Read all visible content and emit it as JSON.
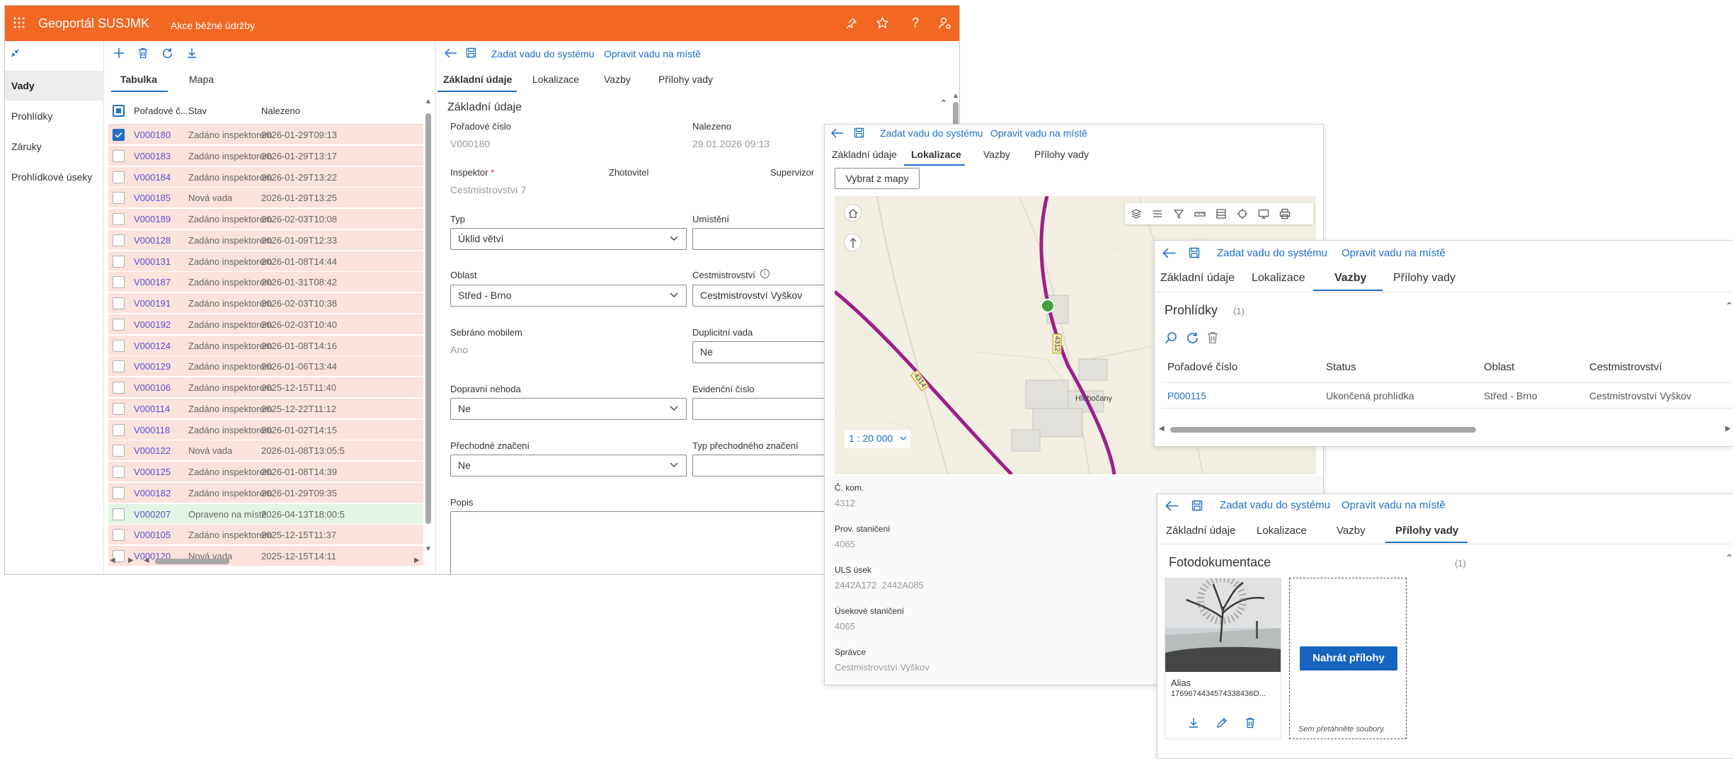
{
  "header": {
    "app_title": "Geoportál SUSJMK",
    "subtitle": "Akce běžné údržby",
    "bg_color": "#f26722"
  },
  "sidebar": {
    "items": [
      "Vady",
      "Prohlídky",
      "Záruky",
      "Prohlídkové úseky"
    ],
    "active": 0
  },
  "list": {
    "tabs": [
      "Tabulka",
      "Mapa"
    ],
    "columns": [
      "Pořadové č...",
      "Stav",
      "Nalezeno"
    ],
    "rows": [
      {
        "id": "V000180",
        "status": "Zadáno inspektorem",
        "date": "2026-01-29T09:13",
        "checked": true,
        "color": "#fbe2dc"
      },
      {
        "id": "V000183",
        "status": "Zadáno inspektorem",
        "date": "2026-01-29T13:17",
        "color": "#fbe2dc"
      },
      {
        "id": "V000184",
        "status": "Zadáno inspektorem",
        "date": "2026-01-29T13:22",
        "color": "#fbe2dc"
      },
      {
        "id": "V000185",
        "status": "Nová vada",
        "date": "2026-01-29T13:25",
        "color": "#fbe2dc"
      },
      {
        "id": "V000189",
        "status": "Zadáno inspektorem",
        "date": "2026-02-03T10:08",
        "color": "#fbe2dc"
      },
      {
        "id": "V000128",
        "status": "Zadáno inspektorem",
        "date": "2026-01-09T12:33",
        "color": "#fbe2dc"
      },
      {
        "id": "V000131",
        "status": "Zadáno inspektorem",
        "date": "2026-01-08T14:44",
        "color": "#fbe2dc"
      },
      {
        "id": "V000187",
        "status": "Zadáno inspektorem",
        "date": "2026-01-31T08:42",
        "color": "#fbe2dc"
      },
      {
        "id": "V000191",
        "status": "Zadáno inspektorem",
        "date": "2026-02-03T10:38",
        "color": "#fbe2dc"
      },
      {
        "id": "V000192",
        "status": "Zadáno inspektorem",
        "date": "2026-02-03T10:40",
        "color": "#fbe2dc"
      },
      {
        "id": "V000124",
        "status": "Zadáno inspektorem",
        "date": "2026-01-08T14:16",
        "color": "#fbe2dc"
      },
      {
        "id": "V000129",
        "status": "Zadáno inspektorem",
        "date": "2026-01-06T13:44",
        "color": "#fbe2dc"
      },
      {
        "id": "V000106",
        "status": "Zadáno inspektorem",
        "date": "2025-12-15T11:40",
        "color": "#fbe2dc"
      },
      {
        "id": "V000114",
        "status": "Zadáno inspektorem",
        "date": "2025-12-22T11:12",
        "color": "#fbe2dc"
      },
      {
        "id": "V000118",
        "status": "Zadáno inspektorem",
        "date": "2026-01-02T14:15",
        "color": "#fbe2dc"
      },
      {
        "id": "V000122",
        "status": "Nová vada",
        "date": "2026-01-08T13:05:5",
        "color": "#fbe2dc"
      },
      {
        "id": "V000125",
        "status": "Zadáno inspektorem",
        "date": "2026-01-08T14:39",
        "color": "#fbe2dc"
      },
      {
        "id": "V000182",
        "status": "Zadáno inspektorem",
        "date": "2026-01-29T09:35",
        "color": "#fbe2dc"
      },
      {
        "id": "V000207",
        "status": "Opraveno na místě",
        "date": "2026-04-13T18:00:5",
        "color": "#e3f4e4"
      },
      {
        "id": "V000105",
        "status": "Zadáno inspektorem",
        "date": "2025-12-15T11:37",
        "color": "#fbe2dc"
      },
      {
        "id": "V000120",
        "status": "Nová vada",
        "date": "2025-12-15T14:11",
        "color": "#fbe2dc"
      }
    ]
  },
  "detail": {
    "actions": {
      "submit": "Zadat vadu do systému",
      "fix": "Opravit vadu na místě"
    },
    "tabs": [
      "Základní údaje",
      "Lokalizace",
      "Vazby",
      "Přílohy vady"
    ],
    "section_title": "Základní údaje",
    "fields": {
      "poradove_label": "Pořadové číslo",
      "poradove_value": "V000180",
      "nalezeno_label": "Nalezeno",
      "nalezeno_value": "29.01.2026 09:13",
      "inspektor_label": "Inspektor",
      "required_mark": "*",
      "inspektor_value": "Cestmistrovství 7",
      "zhotovitel_label": "Zhotovitel",
      "supervizor_label": "Supervizor",
      "typ_label": "Typ",
      "typ_value": "Úklid větví",
      "umisteni_label": "Umístění",
      "oblast_label": "Oblast",
      "oblast_value": "Střed - Brno",
      "cestm_label": "Cestmistrovství",
      "cestm_value": "Cestmistrovství Vyškov",
      "sebrano_label": "Sebráno mobilem",
      "sebrano_value": "Ano",
      "duplicitni_label": "Duplicitní vada",
      "duplicitni_value": "Ne",
      "nehoda_label": "Dopravní nehoda",
      "nehoda_value": "Ne",
      "evidencni_label": "Evidenční číslo",
      "prechodne_label": "Přechodné značení",
      "prechodne_value": "Ne",
      "typ_prechod_label": "Typ přechodného značení",
      "popis_label": "Popis"
    }
  },
  "lokalizace": {
    "button": "Vybrat z mapy",
    "scale": "1 : 20 000",
    "map_labels": {
      "road1": "4312",
      "road2": "4314",
      "town": "Hlubočany"
    },
    "fields": [
      {
        "label": "Č. kom.",
        "value": "4312"
      },
      {
        "label": "Prov. staničení",
        "value": "4065"
      },
      {
        "label": "ULS úsek",
        "value": "2442A172  2442A085"
      },
      {
        "label": "Úsekové staničení",
        "value": "4065"
      },
      {
        "label": "Správce",
        "value": "Cestmistrovství Vyškov"
      }
    ]
  },
  "vazby": {
    "section": "Prohlídky",
    "count": "(1)",
    "columns": [
      "Pořadové číslo",
      "Status",
      "Oblast",
      "Cestmistrovství"
    ],
    "row": [
      "P000115",
      "Ukončená prohlídka",
      "Střed - Brno",
      "Cestmistrovství Vyškov"
    ]
  },
  "prilohy": {
    "section": "Fotodokumentace",
    "count": "(1)",
    "alias_label": "Alias",
    "alias_value": "1769674434574338436O...",
    "upload_button": "Nahrát přílohy",
    "drop_text": "Sem přetáhněte soubory."
  }
}
